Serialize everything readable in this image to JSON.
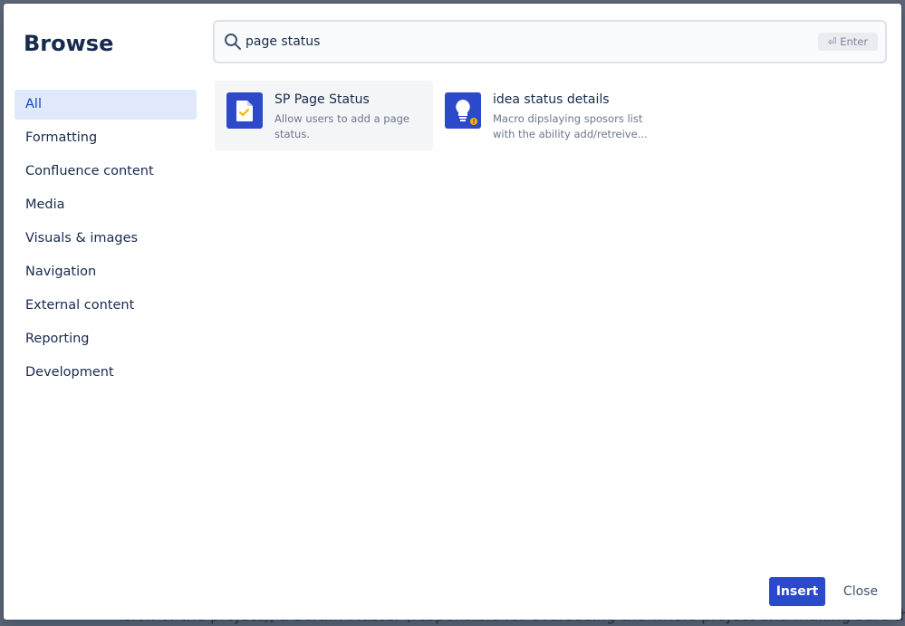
{
  "background": {
    "partial_text": "ision of the project), a Scrum Master (responsible for overseeing the whole project and making sure the"
  },
  "dialog": {
    "title": "Browse"
  },
  "sidebar": {
    "items": [
      {
        "label": "All",
        "active": true
      },
      {
        "label": "Formatting"
      },
      {
        "label": "Confluence content"
      },
      {
        "label": "Media"
      },
      {
        "label": "Visuals & images"
      },
      {
        "label": "Navigation"
      },
      {
        "label": "External content"
      },
      {
        "label": "Reporting"
      },
      {
        "label": "Development"
      }
    ]
  },
  "search": {
    "value": "page status",
    "enter_hint": "⏎ Enter"
  },
  "results": [
    {
      "title": "SP Page Status",
      "desc_line1": "Allow users to add a page",
      "desc_line2": "status.",
      "icon": "page-status-icon"
    },
    {
      "title": "idea status details",
      "desc_line1": "Macro dipslaying sposors list",
      "desc_line2": "with the ability add/retreive...",
      "icon": "lightbulb-icon"
    }
  ],
  "footer": {
    "insert_label": "Insert",
    "close_label": "Close"
  },
  "colors": {
    "accent": "#2c49c9",
    "active_bg": "#dfe9fb",
    "active_text": "#0c48c2",
    "text": "#172b4d",
    "muted": "#6b778c"
  }
}
